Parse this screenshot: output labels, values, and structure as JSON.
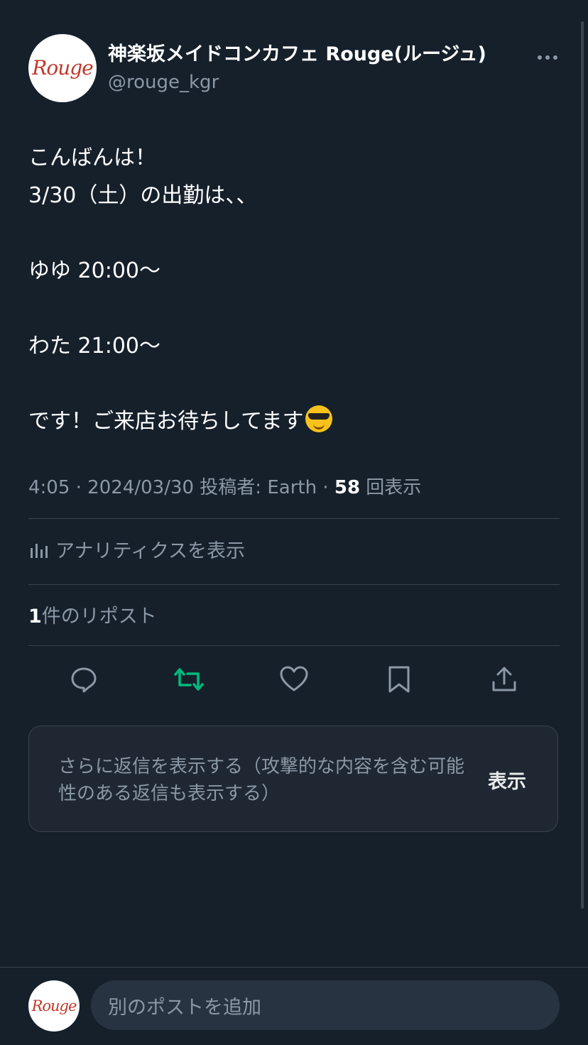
{
  "tweet": {
    "author": {
      "display_name": "神楽坂メイドコンカフェ Rouge(ルージュ)",
      "handle": "@rouge_kgr",
      "avatar_logo_text": "Rouge"
    },
    "body_lines": [
      "こんばんは！",
      "3/30（土）の出勤は、、",
      "",
      "ゆゆ 20:00〜",
      "",
      "わた 21:00〜",
      "",
      "です！ご来店お待ちしてます"
    ],
    "emoji": "smiling-face-with-sunglasses",
    "meta": {
      "time_date": "4:05 · 2024/03/30",
      "posted_by": " 投稿者: Earth · ",
      "views_count": "58",
      "views_label": " 回表示"
    },
    "analytics_label": "アナリティクスを表示",
    "reposts": {
      "count": "1",
      "label": "件のリポスト"
    },
    "actions": {
      "reply": "reply-icon",
      "repost": "repost-icon",
      "like": "heart-icon",
      "bookmark": "bookmark-icon",
      "share": "share-icon"
    },
    "colors": {
      "repost_active": "#00ba7c",
      "background": "#15202b",
      "muted": "#8b98a5"
    }
  },
  "more_replies": {
    "text": "さらに返信を表示する（攻撃的な内容を含む可能性のある返信も表示する）",
    "button_label": "表示"
  },
  "composer": {
    "placeholder": "別のポストを追加"
  }
}
